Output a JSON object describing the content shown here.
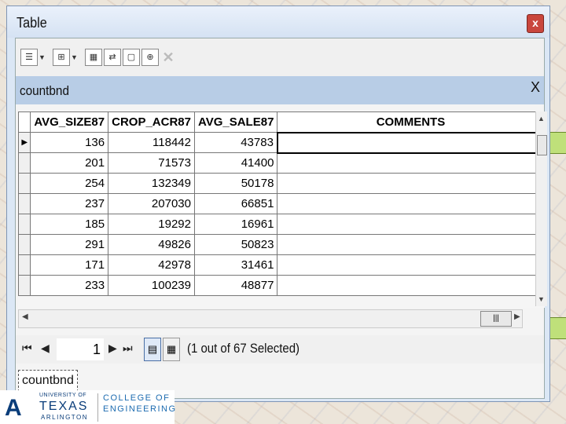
{
  "window": {
    "title": "Table",
    "close": "x"
  },
  "tab": {
    "name": "countbnd",
    "close": "X"
  },
  "table": {
    "columns": [
      "AVG_SIZE87",
      "CROP_ACR87",
      "AVG_SALE87",
      "COMMENTS"
    ],
    "rows": [
      [
        "136",
        "118442",
        "43783",
        ""
      ],
      [
        "201",
        "71573",
        "41400",
        ""
      ],
      [
        "254",
        "132349",
        "50178",
        ""
      ],
      [
        "237",
        "207030",
        "66851",
        ""
      ],
      [
        "185",
        "19292",
        "16961",
        ""
      ],
      [
        "291",
        "49826",
        "50823",
        ""
      ],
      [
        "171",
        "42978",
        "31461",
        ""
      ],
      [
        "233",
        "100239",
        "48877",
        ""
      ]
    ]
  },
  "nav": {
    "first": "⏮",
    "prev": "◀",
    "record": "1",
    "next": "▶",
    "last": "⏭"
  },
  "status": "(1 out of 67 Selected)",
  "bottom_tab": "countbnd",
  "logo": {
    "university_of": "UNIVERSITY OF",
    "texas": "TEXAS",
    "arlington": "ARLINGTON",
    "college_of": "COLLEGE OF",
    "engineering": "ENGINEERING"
  },
  "colors": {
    "accent": "#b8cde6",
    "close": "#c9463d",
    "logo": "#0a3d7a"
  }
}
